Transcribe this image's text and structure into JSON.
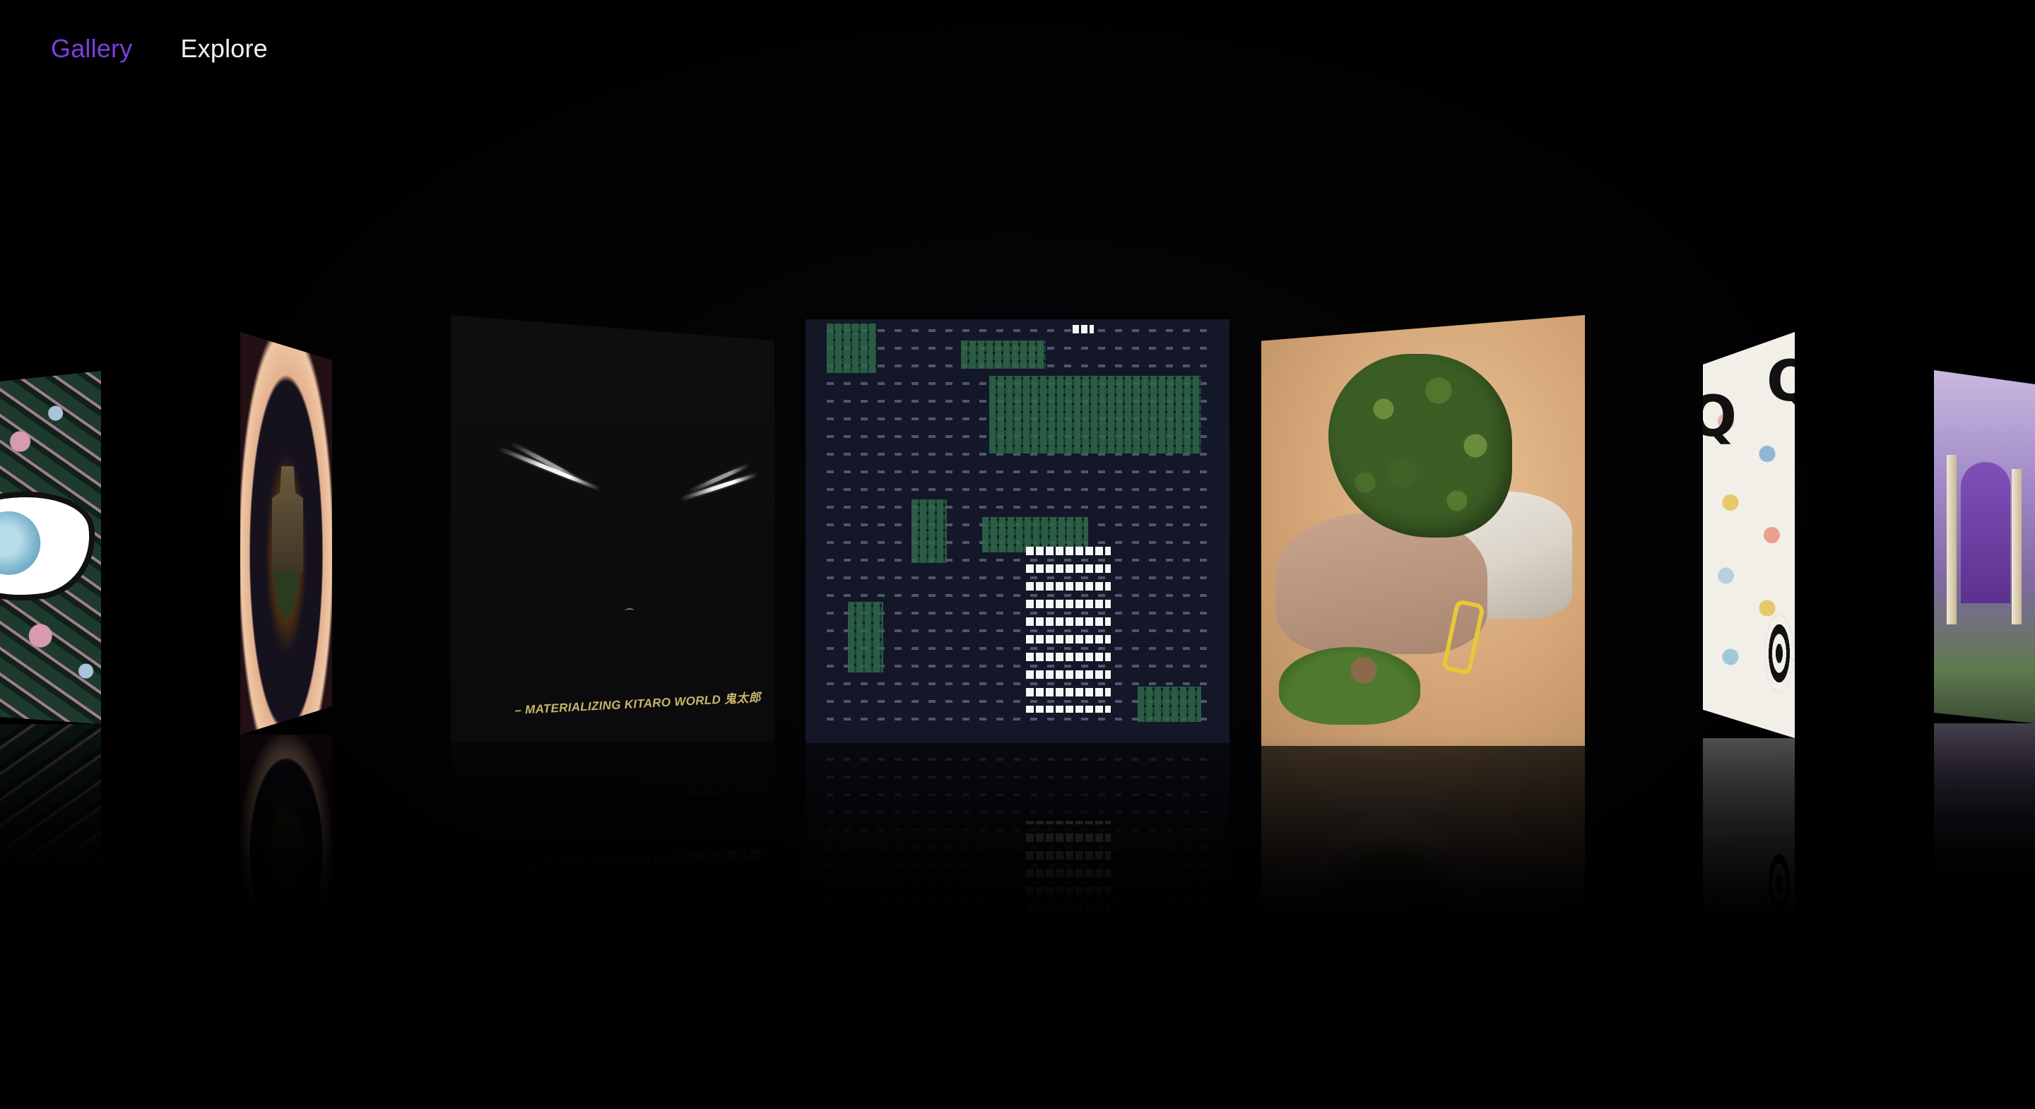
{
  "nav": {
    "items": [
      {
        "label": "Gallery",
        "active": true
      },
      {
        "label": "Explore",
        "active": false
      }
    ],
    "active_color": "#7b3fe0",
    "inactive_color": "#f2f2f2"
  },
  "gallery": {
    "cards": [
      {
        "subject": "eye pattern artwork"
      },
      {
        "subject": "floating castle artwork"
      },
      {
        "subject": "dark face eyes artwork",
        "caption": "– MATERIALIZING KITARO WORLD 鬼太郎"
      },
      {
        "subject": "glyph grid artwork"
      },
      {
        "subject": "medusa voxel sculpture"
      },
      {
        "subject": "Q letter polka dot artwork",
        "letters": [
          "Q",
          "Q"
        ]
      },
      {
        "subject": "palace voxel artwork"
      }
    ]
  },
  "theme": {
    "background": "#000000",
    "accent": "#7b3fe0"
  }
}
